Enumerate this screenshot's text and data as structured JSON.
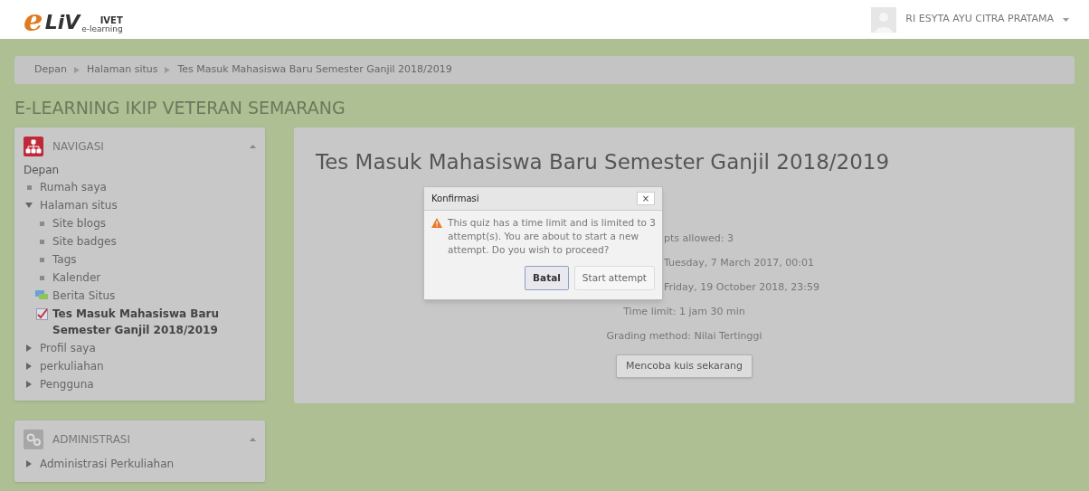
{
  "header": {
    "logo": {
      "initial": "e",
      "main": "LiV",
      "top": "IVET",
      "sub": "e-learning"
    },
    "user": "RI ESYTA AYU CITRA PRATAMA"
  },
  "breadcrumb": [
    "Depan",
    "Halaman situs",
    "Tes Masuk Mahasiswa Baru Semester Ganjil 2018/2019"
  ],
  "site_title": "E-LEARNING IKIP VETERAN SEMARANG",
  "navigation": {
    "title": "NAVIGASI",
    "root": "Depan",
    "items": [
      {
        "label": "Rumah saya",
        "kind": "leaf"
      },
      {
        "label": "Halaman situs",
        "kind": "branch",
        "expanded": true,
        "children": [
          {
            "label": "Site blogs",
            "kind": "leaf"
          },
          {
            "label": "Site badges",
            "kind": "leaf"
          },
          {
            "label": "Tags",
            "kind": "leaf"
          },
          {
            "label": "Kalender",
            "kind": "leaf"
          },
          {
            "label": "Berita Situs",
            "kind": "forum"
          },
          {
            "label": "Tes Masuk Mahasiswa Baru Semester Ganjil 2018/2019",
            "kind": "quiz"
          }
        ]
      },
      {
        "label": "Profil saya",
        "kind": "branch",
        "expanded": false
      },
      {
        "label": "perkuliahan",
        "kind": "branch",
        "expanded": false
      },
      {
        "label": "Pengguna",
        "kind": "branch",
        "expanded": false
      }
    ]
  },
  "administration": {
    "title": "ADMINISTRASI",
    "items": [
      {
        "label": "Administrasi Perkuliahan",
        "kind": "branch",
        "expanded": false
      }
    ]
  },
  "quiz": {
    "title": "Tes Masuk Mahasiswa Baru Semester Ganjil 2018/2019",
    "info": [
      {
        "text": "pts allowed: 3",
        "kind": "partial"
      },
      {
        "text": "Tuesday, 7 March 2017, 00:01",
        "kind": "partial"
      },
      {
        "text": "Friday, 19 October 2018, 23:59",
        "kind": "partial"
      },
      {
        "text": "Time limit: 1 jam 30 min",
        "kind": "full"
      },
      {
        "text": "Grading method: Nilai Tertinggi",
        "kind": "full"
      }
    ],
    "button": "Mencoba kuis sekarang"
  },
  "dialog": {
    "title": "Konfirmasi",
    "close": "×",
    "message": "This quiz has a time limit and is limited to 3 attempt(s). You are about to start a new attempt. Do you wish to proceed?",
    "buttons": [
      {
        "label": "Batal",
        "selected": true
      },
      {
        "label": "Start attempt",
        "selected": false
      }
    ]
  }
}
